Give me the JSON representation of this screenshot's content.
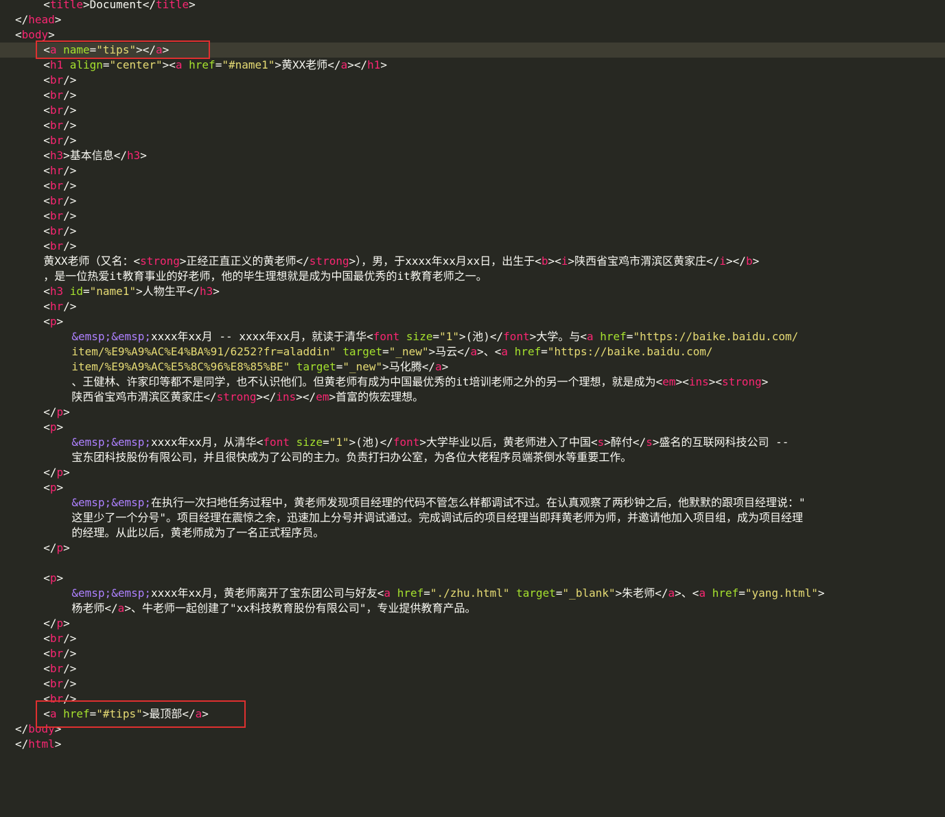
{
  "editor": {
    "theme_colors": {
      "background": "#272822",
      "tag": "#f92672",
      "attribute": "#a6e22e",
      "string": "#e6db74",
      "entity": "#ae81ff",
      "text": "#f8f8f2",
      "annotation_box": "#e03030"
    },
    "lines": [
      {
        "indent": 6,
        "tokens": [
          [
            "p",
            "<"
          ],
          [
            "t",
            "title"
          ],
          [
            "p",
            ">Document</"
          ],
          [
            "t",
            "title"
          ],
          [
            "p",
            ">"
          ]
        ]
      },
      {
        "indent": 2,
        "tokens": [
          [
            "p",
            "</"
          ],
          [
            "t",
            "head"
          ],
          [
            "p",
            ">"
          ]
        ]
      },
      {
        "indent": 2,
        "tokens": [
          [
            "p",
            "<"
          ],
          [
            "t",
            "body"
          ],
          [
            "p",
            ">"
          ]
        ]
      },
      {
        "indent": 6,
        "cur": true,
        "tokens": [
          [
            "p",
            "<"
          ],
          [
            "t",
            "a"
          ],
          [
            "p",
            " "
          ],
          [
            "a",
            "name"
          ],
          [
            "p",
            "="
          ],
          [
            "s",
            "\"tips\""
          ],
          [
            "p",
            "></"
          ],
          [
            "t",
            "a"
          ],
          [
            "p",
            ">"
          ]
        ]
      },
      {
        "indent": 6,
        "tokens": [
          [
            "p",
            "<"
          ],
          [
            "t",
            "h1"
          ],
          [
            "p",
            " "
          ],
          [
            "a",
            "align"
          ],
          [
            "p",
            "="
          ],
          [
            "s",
            "\"center\""
          ],
          [
            "p",
            "><"
          ],
          [
            "t",
            "a"
          ],
          [
            "p",
            " "
          ],
          [
            "a",
            "href"
          ],
          [
            "p",
            "="
          ],
          [
            "s",
            "\"#name1\""
          ],
          [
            "p",
            ">黄XX老师</"
          ],
          [
            "t",
            "a"
          ],
          [
            "p",
            "></"
          ],
          [
            "t",
            "h1"
          ],
          [
            "p",
            ">"
          ]
        ]
      },
      {
        "indent": 6,
        "tokens": [
          [
            "p",
            "<"
          ],
          [
            "t",
            "br"
          ],
          [
            "p",
            "/>"
          ]
        ]
      },
      {
        "indent": 6,
        "tokens": [
          [
            "p",
            "<"
          ],
          [
            "t",
            "br"
          ],
          [
            "p",
            "/>"
          ]
        ]
      },
      {
        "indent": 6,
        "tokens": [
          [
            "p",
            "<"
          ],
          [
            "t",
            "br"
          ],
          [
            "p",
            "/>"
          ]
        ]
      },
      {
        "indent": 6,
        "tokens": [
          [
            "p",
            "<"
          ],
          [
            "t",
            "br"
          ],
          [
            "p",
            "/>"
          ]
        ]
      },
      {
        "indent": 6,
        "tokens": [
          [
            "p",
            "<"
          ],
          [
            "t",
            "br"
          ],
          [
            "p",
            "/>"
          ]
        ]
      },
      {
        "indent": 6,
        "tokens": [
          [
            "p",
            "<"
          ],
          [
            "t",
            "h3"
          ],
          [
            "p",
            ">基本信息</"
          ],
          [
            "t",
            "h3"
          ],
          [
            "p",
            ">"
          ]
        ]
      },
      {
        "indent": 6,
        "tokens": [
          [
            "p",
            "<"
          ],
          [
            "t",
            "hr"
          ],
          [
            "p",
            "/>"
          ]
        ]
      },
      {
        "indent": 6,
        "tokens": [
          [
            "p",
            "<"
          ],
          [
            "t",
            "br"
          ],
          [
            "p",
            "/>"
          ]
        ]
      },
      {
        "indent": 6,
        "tokens": [
          [
            "p",
            "<"
          ],
          [
            "t",
            "br"
          ],
          [
            "p",
            "/>"
          ]
        ]
      },
      {
        "indent": 6,
        "tokens": [
          [
            "p",
            "<"
          ],
          [
            "t",
            "br"
          ],
          [
            "p",
            "/>"
          ]
        ]
      },
      {
        "indent": 6,
        "tokens": [
          [
            "p",
            "<"
          ],
          [
            "t",
            "br"
          ],
          [
            "p",
            "/>"
          ]
        ]
      },
      {
        "indent": 6,
        "tokens": [
          [
            "p",
            "<"
          ],
          [
            "t",
            "br"
          ],
          [
            "p",
            "/>"
          ]
        ]
      },
      {
        "indent": 6,
        "tokens": [
          [
            "p",
            "黄XX老师（又名：<"
          ],
          [
            "t",
            "strong"
          ],
          [
            "p",
            ">正经正直正义的黄老师</"
          ],
          [
            "t",
            "strong"
          ],
          [
            "p",
            ">），男，于xxxx年xx月xx日，出生于<"
          ],
          [
            "t",
            "b"
          ],
          [
            "p",
            "><"
          ],
          [
            "t",
            "i"
          ],
          [
            "p",
            ">陕西省宝鸡市渭滨区黄家庄</"
          ],
          [
            "t",
            "i"
          ],
          [
            "p",
            "></"
          ],
          [
            "t",
            "b"
          ],
          [
            "p",
            ">"
          ]
        ]
      },
      {
        "indent": 6,
        "tokens": [
          [
            "p",
            "，是一位热爱it教育事业的好老师，他的毕生理想就是成为中国最优秀的it教育老师之一。"
          ]
        ]
      },
      {
        "indent": 6,
        "tokens": [
          [
            "p",
            "<"
          ],
          [
            "t",
            "h3"
          ],
          [
            "p",
            " "
          ],
          [
            "a",
            "id"
          ],
          [
            "p",
            "="
          ],
          [
            "s",
            "\"name1\""
          ],
          [
            "p",
            ">人物生平</"
          ],
          [
            "t",
            "h3"
          ],
          [
            "p",
            ">"
          ]
        ]
      },
      {
        "indent": 6,
        "tokens": [
          [
            "p",
            "<"
          ],
          [
            "t",
            "hr"
          ],
          [
            "p",
            "/>"
          ]
        ]
      },
      {
        "indent": 6,
        "tokens": [
          [
            "p",
            "<"
          ],
          [
            "t",
            "p"
          ],
          [
            "p",
            ">"
          ]
        ]
      },
      {
        "indent": 10,
        "tokens": [
          [
            "e",
            "&emsp;&emsp;"
          ],
          [
            "p",
            "xxxx年xx月 -- xxxx年xx月，就读于清华<"
          ],
          [
            "t",
            "font"
          ],
          [
            "p",
            " "
          ],
          [
            "a",
            "size"
          ],
          [
            "p",
            "="
          ],
          [
            "s",
            "\"1\""
          ],
          [
            "p",
            ">(池)</"
          ],
          [
            "t",
            "font"
          ],
          [
            "p",
            ">大学。与<"
          ],
          [
            "t",
            "a"
          ],
          [
            "p",
            " "
          ],
          [
            "a",
            "href"
          ],
          [
            "p",
            "="
          ],
          [
            "s",
            "\"https://baike.baidu.com/"
          ]
        ]
      },
      {
        "indent": 10,
        "tokens": [
          [
            "s",
            "item/%E9%A9%AC%E4%BA%91/6252?fr=aladdin\""
          ],
          [
            "p",
            " "
          ],
          [
            "a",
            "target"
          ],
          [
            "p",
            "="
          ],
          [
            "s",
            "\"_new\""
          ],
          [
            "p",
            ">马云</"
          ],
          [
            "t",
            "a"
          ],
          [
            "p",
            ">、<"
          ],
          [
            "t",
            "a"
          ],
          [
            "p",
            " "
          ],
          [
            "a",
            "href"
          ],
          [
            "p",
            "="
          ],
          [
            "s",
            "\"https://baike.baidu.com/"
          ]
        ]
      },
      {
        "indent": 10,
        "tokens": [
          [
            "s",
            "item/%E9%A9%AC%E5%8C%96%E8%85%BE\""
          ],
          [
            "p",
            " "
          ],
          [
            "a",
            "target"
          ],
          [
            "p",
            "="
          ],
          [
            "s",
            "\"_new\""
          ],
          [
            "p",
            ">马化腾</"
          ],
          [
            "t",
            "a"
          ],
          [
            "p",
            ">"
          ]
        ]
      },
      {
        "indent": 10,
        "tokens": [
          [
            "p",
            "、王健林、许家印等都不是同学，也不认识他们。但黄老师有成为中国最优秀的it培训老师之外的另一个理想，就是成为<"
          ],
          [
            "t",
            "em"
          ],
          [
            "p",
            "><"
          ],
          [
            "t",
            "ins"
          ],
          [
            "p",
            "><"
          ],
          [
            "t",
            "strong"
          ],
          [
            "p",
            ">"
          ]
        ]
      },
      {
        "indent": 10,
        "tokens": [
          [
            "p",
            "陕西省宝鸡市渭滨区黄家庄</"
          ],
          [
            "t",
            "strong"
          ],
          [
            "p",
            "></"
          ],
          [
            "t",
            "ins"
          ],
          [
            "p",
            "></"
          ],
          [
            "t",
            "em"
          ],
          [
            "p",
            ">首富的恢宏理想。"
          ]
        ]
      },
      {
        "indent": 6,
        "tokens": [
          [
            "p",
            "</"
          ],
          [
            "t",
            "p"
          ],
          [
            "p",
            ">"
          ]
        ]
      },
      {
        "indent": 6,
        "tokens": [
          [
            "p",
            "<"
          ],
          [
            "t",
            "p"
          ],
          [
            "p",
            ">"
          ]
        ]
      },
      {
        "indent": 10,
        "tokens": [
          [
            "e",
            "&emsp;&emsp;"
          ],
          [
            "p",
            "xxxx年xx月，从清华<"
          ],
          [
            "t",
            "font"
          ],
          [
            "p",
            " "
          ],
          [
            "a",
            "size"
          ],
          [
            "p",
            "="
          ],
          [
            "s",
            "\"1\""
          ],
          [
            "p",
            ">(池)</"
          ],
          [
            "t",
            "font"
          ],
          [
            "p",
            ">大学毕业以后，黄老师进入了中国<"
          ],
          [
            "t",
            "s"
          ],
          [
            "p",
            ">醉付</"
          ],
          [
            "t",
            "s"
          ],
          [
            "p",
            ">盛名的互联网科技公司 --"
          ]
        ]
      },
      {
        "indent": 10,
        "tokens": [
          [
            "p",
            "宝东团科技股份有限公司，并且很快成为了公司的主力。负责打扫办公室，为各位大佬程序员端茶倒水等重要工作。"
          ]
        ]
      },
      {
        "indent": 6,
        "tokens": [
          [
            "p",
            "</"
          ],
          [
            "t",
            "p"
          ],
          [
            "p",
            ">"
          ]
        ]
      },
      {
        "indent": 6,
        "tokens": [
          [
            "p",
            "<"
          ],
          [
            "t",
            "p"
          ],
          [
            "p",
            ">"
          ]
        ]
      },
      {
        "indent": 10,
        "tokens": [
          [
            "e",
            "&emsp;&emsp;"
          ],
          [
            "p",
            "在执行一次扫地任务过程中，黄老师发现项目经理的代码不管怎么样都调试不过。在认真观察了两秒钟之后，他默默的跟项目经理说：\""
          ]
        ]
      },
      {
        "indent": 10,
        "tokens": [
          [
            "p",
            "这里少了一个分号\"。项目经理在震惊之余，迅速加上分号并调试通过。完成调试后的项目经理当即拜黄老师为师，并邀请他加入项目组，成为项目经理"
          ]
        ]
      },
      {
        "indent": 10,
        "tokens": [
          [
            "p",
            "的经理。从此以后，黄老师成为了一名正式程序员。"
          ]
        ]
      },
      {
        "indent": 6,
        "tokens": [
          [
            "p",
            "</"
          ],
          [
            "t",
            "p"
          ],
          [
            "p",
            ">"
          ]
        ]
      },
      {
        "indent": 0,
        "tokens": []
      },
      {
        "indent": 6,
        "tokens": [
          [
            "p",
            "<"
          ],
          [
            "t",
            "p"
          ],
          [
            "p",
            ">"
          ]
        ]
      },
      {
        "indent": 10,
        "tokens": [
          [
            "e",
            "&emsp;&emsp;"
          ],
          [
            "p",
            "xxxx年xx月，黄老师离开了宝东团公司与好友<"
          ],
          [
            "t",
            "a"
          ],
          [
            "p",
            " "
          ],
          [
            "a",
            "href"
          ],
          [
            "p",
            "="
          ],
          [
            "s",
            "\"./zhu.html\""
          ],
          [
            "p",
            " "
          ],
          [
            "a",
            "target"
          ],
          [
            "p",
            "="
          ],
          [
            "s",
            "\"_blank\""
          ],
          [
            "p",
            ">朱老师</"
          ],
          [
            "t",
            "a"
          ],
          [
            "p",
            ">、<"
          ],
          [
            "t",
            "a"
          ],
          [
            "p",
            " "
          ],
          [
            "a",
            "href"
          ],
          [
            "p",
            "="
          ],
          [
            "s",
            "\"yang.html\""
          ],
          [
            "p",
            ">"
          ]
        ]
      },
      {
        "indent": 10,
        "tokens": [
          [
            "p",
            "杨老师</"
          ],
          [
            "t",
            "a"
          ],
          [
            "p",
            ">、牛老师一起创建了\"xx科技教育股份有限公司\"，专业提供教育产品。"
          ]
        ]
      },
      {
        "indent": 6,
        "tokens": [
          [
            "p",
            "</"
          ],
          [
            "t",
            "p"
          ],
          [
            "p",
            ">"
          ]
        ]
      },
      {
        "indent": 6,
        "tokens": [
          [
            "p",
            "<"
          ],
          [
            "t",
            "br"
          ],
          [
            "p",
            "/>"
          ]
        ]
      },
      {
        "indent": 6,
        "tokens": [
          [
            "p",
            "<"
          ],
          [
            "t",
            "br"
          ],
          [
            "p",
            "/>"
          ]
        ]
      },
      {
        "indent": 6,
        "tokens": [
          [
            "p",
            "<"
          ],
          [
            "t",
            "br"
          ],
          [
            "p",
            "/>"
          ]
        ]
      },
      {
        "indent": 6,
        "tokens": [
          [
            "p",
            "<"
          ],
          [
            "t",
            "br"
          ],
          [
            "p",
            "/>"
          ]
        ]
      },
      {
        "indent": 6,
        "tokens": [
          [
            "p",
            "<"
          ],
          [
            "t",
            "br"
          ],
          [
            "p",
            "/>"
          ]
        ]
      },
      {
        "indent": 6,
        "tokens": [
          [
            "p",
            "<"
          ],
          [
            "t",
            "a"
          ],
          [
            "p",
            " "
          ],
          [
            "a",
            "href"
          ],
          [
            "p",
            "="
          ],
          [
            "s",
            "\"#tips\""
          ],
          [
            "p",
            ">最顶部</"
          ],
          [
            "t",
            "a"
          ],
          [
            "p",
            ">"
          ]
        ]
      },
      {
        "indent": 2,
        "tokens": [
          [
            "p",
            "</"
          ],
          [
            "t",
            "body"
          ],
          [
            "p",
            ">"
          ]
        ]
      },
      {
        "indent": 2,
        "tokens": [
          [
            "p",
            "</"
          ],
          [
            "t",
            "html"
          ],
          [
            "p",
            ">"
          ]
        ]
      }
    ]
  }
}
